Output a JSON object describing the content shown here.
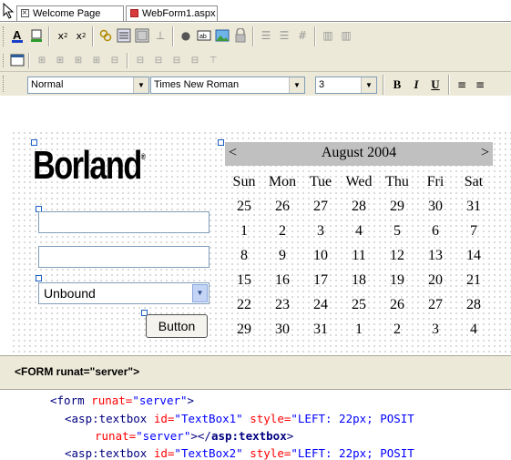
{
  "tabs": [
    {
      "label": "Welcome Page",
      "icon": "close-icon"
    },
    {
      "label": "WebForm1.aspx",
      "icon": "webform-icon",
      "active": true
    }
  ],
  "toolbar": {
    "format_block": "Normal",
    "font_family": "Times New Roman",
    "font_size": "3",
    "bold_label": "B",
    "italic_label": "I",
    "underline_label": "U"
  },
  "design": {
    "logo_text": "Borland",
    "logo_mark": "®",
    "dropdown_value": "Unbound",
    "button_label": "Button"
  },
  "calendar": {
    "prev_label": "<",
    "next_label": ">",
    "title": "August 2004",
    "day_headers": [
      "Sun",
      "Mon",
      "Tue",
      "Wed",
      "Thu",
      "Fri",
      "Sat"
    ],
    "weeks": [
      [
        "25",
        "26",
        "27",
        "28",
        "29",
        "30",
        "31"
      ],
      [
        "1",
        "2",
        "3",
        "4",
        "5",
        "6",
        "7"
      ],
      [
        "8",
        "9",
        "10",
        "11",
        "12",
        "13",
        "14"
      ],
      [
        "15",
        "16",
        "17",
        "18",
        "19",
        "20",
        "21"
      ],
      [
        "22",
        "23",
        "24",
        "25",
        "26",
        "27",
        "28"
      ],
      [
        "29",
        "30",
        "31",
        "1",
        "2",
        "3",
        "4"
      ]
    ]
  },
  "tag_bar": "<FORM runat=\"server\">",
  "source": {
    "line1_tag_open": "<form",
    "line1_attr": " runat=",
    "line1_val": "\"server\"",
    "line1_close": ">",
    "line2_tag": "<asp:textbox",
    "line2_attr1": " id=",
    "line2_val1": "\"TextBox1\"",
    "line2_attr2": " style=",
    "line2_val2": "\"LEFT: 22px; POSIT",
    "line3_attr": "runat=",
    "line3_val": "\"server\"",
    "line3_close": "></",
    "line3_tag": "asp:textbox",
    "line3_end": ">",
    "line4_tag": "<asp:textbox",
    "line4_attr1": " id=",
    "line4_val1": "\"TextBox2\"",
    "line4_attr2": " style=",
    "line4_val2": "\"LEFT: 22px; POSIT"
  },
  "colors": {
    "tag": "#000080",
    "attr": "#ff0000",
    "value": "#0000ff",
    "calendar_header": "#c0c0c0",
    "toolbar_bg": "#ece9d8"
  }
}
